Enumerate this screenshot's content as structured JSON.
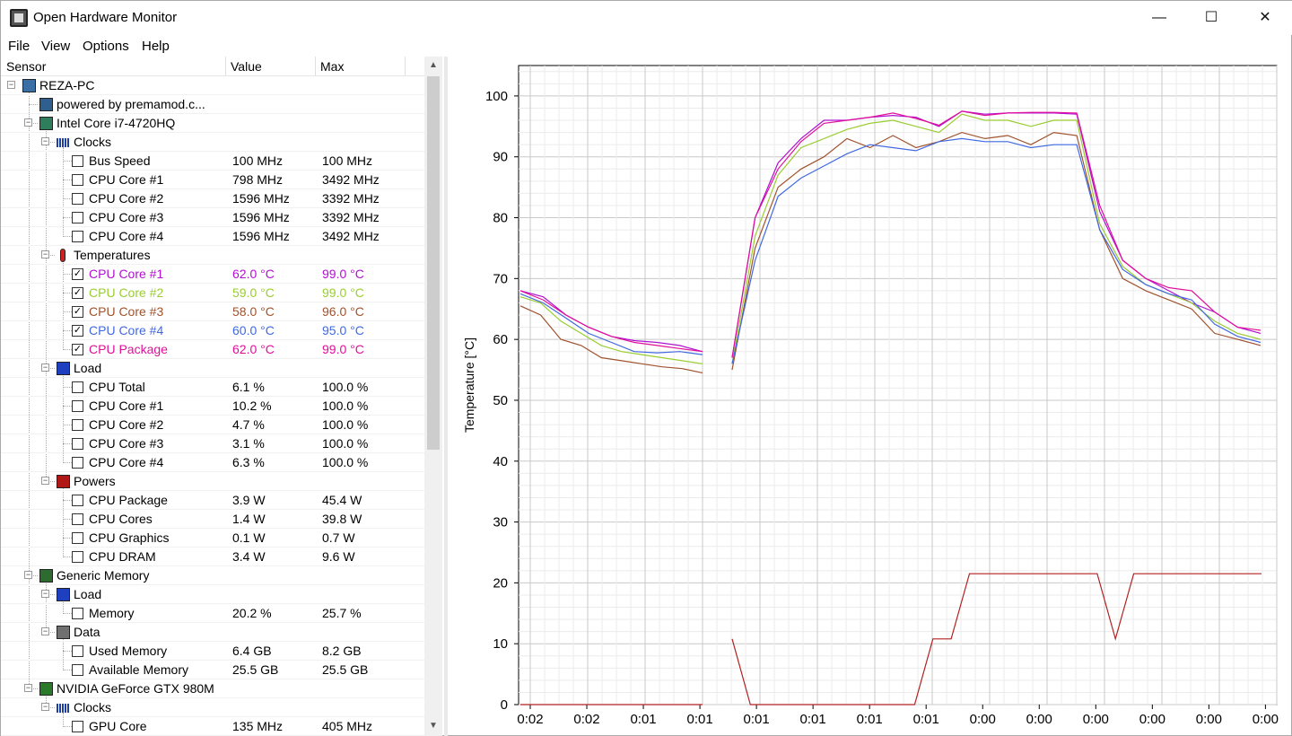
{
  "window": {
    "title": "Open Hardware Monitor",
    "minimize": "—",
    "maximize": "☐",
    "close": "✕"
  },
  "menu": [
    "File",
    "View",
    "Options",
    "Help"
  ],
  "columns": {
    "sensor": "Sensor",
    "value": "Value",
    "max": "Max"
  },
  "rows": [
    {
      "label": "REZA-PC",
      "level": 0,
      "type": "node",
      "icon": "computer-icon",
      "expanded": true
    },
    {
      "label": "powered by premamod.c...",
      "level": 1,
      "type": "leaf",
      "icon": "mainboard-icon"
    },
    {
      "label": "Intel Core i7-4720HQ",
      "level": 1,
      "type": "node",
      "icon": "cpu-icon",
      "expanded": true
    },
    {
      "label": "Clocks",
      "level": 2,
      "type": "node",
      "icon": "clock-icon",
      "expanded": true
    },
    {
      "label": "Bus Speed",
      "level": 3,
      "type": "sensor",
      "checked": false,
      "value": "100 MHz",
      "max": "100 MHz"
    },
    {
      "label": "CPU Core #1",
      "level": 3,
      "type": "sensor",
      "checked": false,
      "value": "798 MHz",
      "max": "3492 MHz"
    },
    {
      "label": "CPU Core #2",
      "level": 3,
      "type": "sensor",
      "checked": false,
      "value": "1596 MHz",
      "max": "3392 MHz"
    },
    {
      "label": "CPU Core #3",
      "level": 3,
      "type": "sensor",
      "checked": false,
      "value": "1596 MHz",
      "max": "3392 MHz"
    },
    {
      "label": "CPU Core #4",
      "level": 3,
      "type": "sensor",
      "checked": false,
      "value": "1596 MHz",
      "max": "3492 MHz"
    },
    {
      "label": "Temperatures",
      "level": 2,
      "type": "node",
      "icon": "thermometer-icon",
      "expanded": true
    },
    {
      "label": "CPU Core #1",
      "level": 3,
      "type": "sensor",
      "checked": true,
      "value": "62.0 °C",
      "max": "99.0 °C",
      "color": "#b010d0"
    },
    {
      "label": "CPU Core #2",
      "level": 3,
      "type": "sensor",
      "checked": true,
      "value": "59.0 °C",
      "max": "99.0 °C",
      "color": "#9acd32"
    },
    {
      "label": "CPU Core #3",
      "level": 3,
      "type": "sensor",
      "checked": true,
      "value": "58.0 °C",
      "max": "96.0 °C",
      "color": "#a0522d"
    },
    {
      "label": "CPU Core #4",
      "level": 3,
      "type": "sensor",
      "checked": true,
      "value": "60.0 °C",
      "max": "95.0 °C",
      "color": "#4169e1"
    },
    {
      "label": "CPU Package",
      "level": 3,
      "type": "sensor",
      "checked": true,
      "value": "62.0 °C",
      "max": "99.0 °C",
      "color": "#e0109c"
    },
    {
      "label": "Load",
      "level": 2,
      "type": "node",
      "icon": "load-icon",
      "expanded": true
    },
    {
      "label": "CPU Total",
      "level": 3,
      "type": "sensor",
      "checked": false,
      "value": "6.1 %",
      "max": "100.0 %"
    },
    {
      "label": "CPU Core #1",
      "level": 3,
      "type": "sensor",
      "checked": false,
      "value": "10.2 %",
      "max": "100.0 %"
    },
    {
      "label": "CPU Core #2",
      "level": 3,
      "type": "sensor",
      "checked": false,
      "value": "4.7 %",
      "max": "100.0 %"
    },
    {
      "label": "CPU Core #3",
      "level": 3,
      "type": "sensor",
      "checked": false,
      "value": "3.1 %",
      "max": "100.0 %"
    },
    {
      "label": "CPU Core #4",
      "level": 3,
      "type": "sensor",
      "checked": false,
      "value": "6.3 %",
      "max": "100.0 %"
    },
    {
      "label": "Powers",
      "level": 2,
      "type": "node",
      "icon": "power-icon",
      "expanded": true
    },
    {
      "label": "CPU Package",
      "level": 3,
      "type": "sensor",
      "checked": false,
      "value": "3.9 W",
      "max": "45.4 W"
    },
    {
      "label": "CPU Cores",
      "level": 3,
      "type": "sensor",
      "checked": false,
      "value": "1.4 W",
      "max": "39.8 W"
    },
    {
      "label": "CPU Graphics",
      "level": 3,
      "type": "sensor",
      "checked": false,
      "value": "0.1 W",
      "max": "0.7 W"
    },
    {
      "label": "CPU DRAM",
      "level": 3,
      "type": "sensor",
      "checked": false,
      "value": "3.4 W",
      "max": "9.6 W"
    },
    {
      "label": "Generic Memory",
      "level": 1,
      "type": "node",
      "icon": "memory-icon",
      "expanded": true
    },
    {
      "label": "Load",
      "level": 2,
      "type": "node",
      "icon": "load-icon",
      "expanded": true
    },
    {
      "label": "Memory",
      "level": 3,
      "type": "sensor",
      "checked": false,
      "value": "20.2 %",
      "max": "25.7 %"
    },
    {
      "label": "Data",
      "level": 2,
      "type": "node",
      "icon": "data-icon",
      "expanded": true
    },
    {
      "label": "Used Memory",
      "level": 3,
      "type": "sensor",
      "checked": false,
      "value": "6.4 GB",
      "max": "8.2 GB"
    },
    {
      "label": "Available Memory",
      "level": 3,
      "type": "sensor",
      "checked": false,
      "value": "25.5 GB",
      "max": "25.5 GB"
    },
    {
      "label": "NVIDIA GeForce GTX 980M",
      "level": 1,
      "type": "node",
      "icon": "gpu-icon",
      "expanded": true
    },
    {
      "label": "Clocks",
      "level": 2,
      "type": "node",
      "icon": "clock-icon",
      "expanded": true
    },
    {
      "label": "GPU Core",
      "level": 3,
      "type": "sensor",
      "checked": false,
      "value": "135 MHz",
      "max": "405 MHz"
    }
  ],
  "chart_data": {
    "type": "line",
    "ylabel": "Temperature [°C]",
    "ylim": [
      0,
      105
    ],
    "yticks": [
      0,
      10,
      20,
      30,
      40,
      50,
      60,
      70,
      80,
      90,
      100
    ],
    "xtick_labels": [
      "0:02",
      "0:02",
      "0:01",
      "0:01",
      "0:01",
      "0:01",
      "0:01",
      "0:01",
      "0:00",
      "0:00",
      "0:00",
      "0:00",
      "0:00",
      "0:00"
    ],
    "grid": true,
    "series": [
      {
        "name": "CPU Core #1",
        "color": "#b010d0",
        "segments": [
          [
            68,
            67,
            64,
            62,
            60.5,
            59.8,
            59.5,
            59.0,
            58.0
          ],
          [
            57,
            80,
            89,
            93,
            96,
            96,
            96.5,
            96.8,
            96.5,
            95,
            97.5,
            97,
            97.2,
            97.2,
            97.2,
            97,
            81,
            73,
            70,
            68,
            66,
            64.5,
            62,
            61
          ]
        ]
      },
      {
        "name": "CPU Core #2",
        "color": "#9acd32",
        "segments": [
          [
            67,
            66,
            63,
            61,
            59,
            58,
            57.5,
            57,
            56.5,
            56
          ],
          [
            56,
            77,
            87,
            91.5,
            93,
            94.5,
            95.5,
            96,
            95,
            94,
            97,
            96,
            96,
            95,
            96,
            96,
            79,
            72,
            69,
            67.5,
            66,
            63,
            61,
            60
          ]
        ]
      },
      {
        "name": "CPU Core #3",
        "color": "#a0522d",
        "segments": [
          [
            65.5,
            64,
            60,
            59,
            57,
            56.5,
            56,
            55.5,
            55.2,
            54.5
          ],
          [
            55,
            75,
            85,
            88,
            90,
            93,
            91.5,
            93.5,
            91.5,
            92.5,
            94,
            93,
            93.5,
            92,
            94,
            93.5,
            78,
            70,
            68,
            66.5,
            65,
            61,
            60,
            59
          ]
        ]
      },
      {
        "name": "CPU Core #4",
        "color": "#4169e1",
        "segments": [
          [
            67.5,
            66,
            63.5,
            61,
            59.5,
            58,
            57.8,
            58,
            57.5
          ],
          [
            56,
            73,
            83.5,
            86.5,
            88.5,
            90.5,
            92,
            91.5,
            91,
            92.5,
            93,
            92.5,
            92.5,
            91.5,
            92,
            92,
            78,
            71.5,
            69,
            67.5,
            66.5,
            62.5,
            60.5,
            59.5
          ]
        ]
      },
      {
        "name": "CPU Package",
        "color": "#e0109c",
        "segments": [
          [
            68,
            66.5,
            64,
            62,
            60.5,
            59.5,
            59,
            58.5,
            58
          ],
          [
            57,
            80,
            88,
            92.5,
            95.5,
            96,
            96.5,
            97.2,
            96.3,
            95.2,
            97.5,
            96.8,
            97.2,
            97.3,
            97.3,
            97.2,
            82,
            73,
            70,
            68.5,
            68,
            64.5,
            62,
            61.5
          ]
        ]
      },
      {
        "name": "",
        "color": "#b22222",
        "segments": [
          [
            0,
            0,
            0,
            0,
            0,
            0,
            0,
            0,
            0,
            0
          ],
          [
            10.8,
            0,
            0,
            0,
            0,
            0,
            0,
            0,
            0,
            0,
            0,
            10.8,
            10.8,
            21.5,
            21.5,
            21.5,
            21.5,
            21.5,
            21.5,
            21.5,
            21.5,
            10.8,
            21.5,
            21.5,
            21.5,
            21.5,
            21.5,
            21.5,
            21.5,
            21.5
          ]
        ]
      }
    ]
  }
}
